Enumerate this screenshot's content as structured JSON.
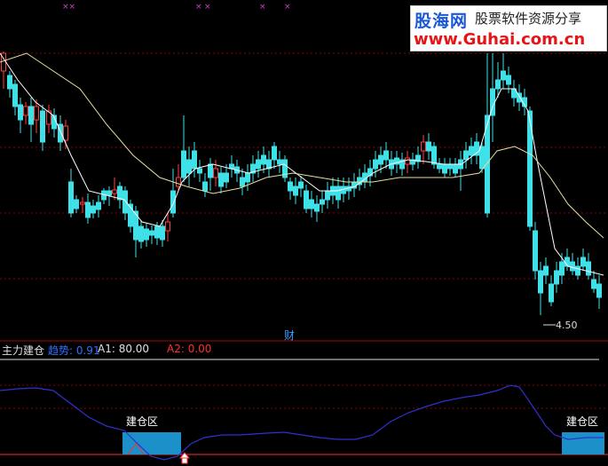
{
  "watermark": {
    "brand": "股海网",
    "slogan": "股票软件资源分享",
    "url": "www.Guhai.com.cn"
  },
  "main_chart": {
    "marker": "财",
    "low_label": "4.50"
  },
  "indicator": {
    "name": "主力建仓",
    "line1_label": "趋势: 0.91",
    "line2_label": "A1: 80.00",
    "line3_label": "A2: 0.00",
    "zone_label_left": "建仓区",
    "zone_label_right": "建仓区"
  },
  "colors": {
    "up": "#ff4040",
    "down": "#40e0e8",
    "ma_short": "#ffffff",
    "ma_long": "#e8e0a0",
    "indicator_line": "#3030d0",
    "zone_fill": "#1c90c8",
    "grid": "#8b0000",
    "label_blue": "#3070ff",
    "label_white": "#e0e0e0",
    "label_red": "#ff3030"
  }
}
